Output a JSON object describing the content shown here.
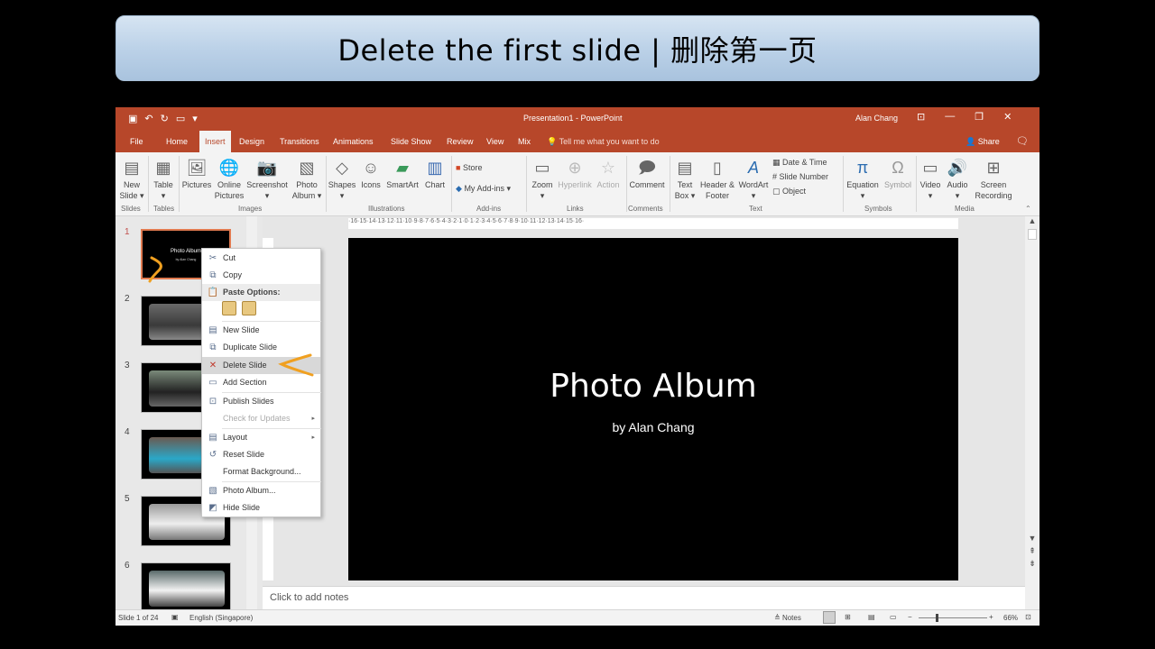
{
  "banner": {
    "text": "Delete the first slide | 删除第一页"
  },
  "window": {
    "title": "Presentation1  -  PowerPoint",
    "user": "Alan Chang",
    "tell_me": "Tell me what you want to do",
    "share": "Share",
    "tabs": [
      "File",
      "Home",
      "Insert",
      "Design",
      "Transitions",
      "Animations",
      "Slide Show",
      "Review",
      "View",
      "Mix"
    ],
    "active_tab": "Insert"
  },
  "ribbon": {
    "groups": [
      "Slides",
      "Tables",
      "Images",
      "Illustrations",
      "Add-ins",
      "Links",
      "Comments",
      "Text",
      "Symbols",
      "Media"
    ],
    "buttons": {
      "new_slide": "New Slide ▾",
      "table": "Table ▾",
      "pictures": "Pictures",
      "online_pictures": "Online Pictures",
      "screenshot": "Screenshot ▾",
      "photo_album": "Photo Album ▾",
      "shapes": "Shapes ▾",
      "icons": "Icons",
      "smartart": "SmartArt",
      "chart": "Chart",
      "store": "Store",
      "my_addins": "My Add-ins ▾",
      "zoom": "Zoom ▾",
      "hyperlink": "Hyperlink",
      "action": "Action",
      "comment": "Comment",
      "text_box": "Text Box ▾",
      "header_footer": "Header & Footer",
      "wordart": "WordArt ▾",
      "date_time": "Date & Time",
      "slide_number": "Slide Number",
      "object": "Object",
      "equation": "Equation ▾",
      "symbol": "Symbol",
      "video": "Video ▾",
      "audio": "Audio ▾",
      "screen_recording": "Screen Recording"
    }
  },
  "thumbnails": {
    "numbers": [
      "1",
      "2",
      "3",
      "4",
      "5",
      "6"
    ],
    "slide1_title": "Photo Album",
    "slide1_sub": "by Alan Chang"
  },
  "ruler_text": "·16·15·14·13·12·11·10·9·8·7·6·5·4·3·2·1·0·1·2·3·4·5·6·7·8·9·10·11·12·13·14·15·16·",
  "slide": {
    "title": "Photo Album",
    "subtitle": "by Alan Chang"
  },
  "notes_placeholder": "Click to add notes",
  "status": {
    "slide_count": "Slide 1 of 24",
    "language": "English (Singapore)",
    "notes": "Notes",
    "zoom": "66%"
  },
  "context_menu": {
    "items": {
      "cut": "Cut",
      "copy": "Copy",
      "paste_options": "Paste Options:",
      "new_slide": "New Slide",
      "duplicate_slide": "Duplicate Slide",
      "delete_slide": "Delete Slide",
      "add_section": "Add Section",
      "publish_slides": "Publish Slides",
      "check_updates": "Check for Updates",
      "layout": "Layout",
      "reset_slide": "Reset Slide",
      "format_background": "Format Background...",
      "photo_album": "Photo Album...",
      "hide_slide": "Hide Slide"
    }
  },
  "colors": {
    "accent": "#b7472a",
    "annotation": "#f0a020"
  }
}
